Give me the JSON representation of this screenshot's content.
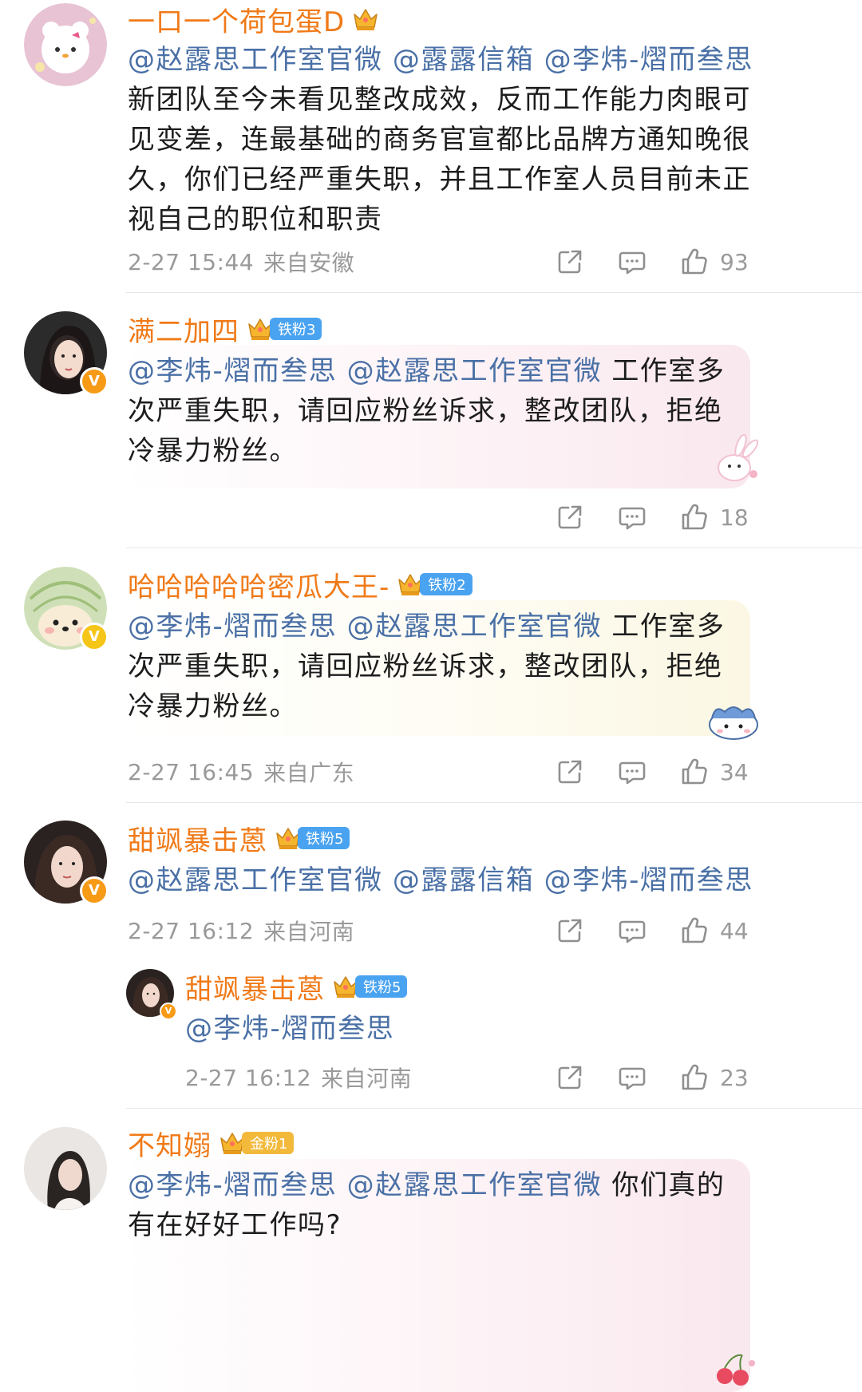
{
  "comments": [
    {
      "username": "一口一个荷包蛋D",
      "fan_badge": "",
      "text_mentions": [
        "@赵露思工作室官微",
        "@露露信箱",
        "@李炜-熠而叁思"
      ],
      "text_body": "新团队至今未看见整改成效，反而工作能力肉眼可见变差，连最基础的商务官宣都比品牌方通知晚很久，你们已经严重失职，并且工作室人员目前未正视自己的职位和职责",
      "timestamp": "2-27 15:44",
      "location": "来自安徽",
      "likes": "93"
    },
    {
      "username": "满二加四",
      "fan_badge": "铁粉3",
      "text_mentions": [
        "@李炜-熠而叁思",
        "@赵露思工作室官微"
      ],
      "text_body": "工作室多次严重失职，请回应粉丝诉求，整改团队，拒绝冷暴力粉丝。",
      "timestamp": "",
      "location": "",
      "likes": "18"
    },
    {
      "username": "哈哈哈哈哈密瓜大王-",
      "fan_badge": "铁粉2",
      "text_mentions": [
        "@李炜-熠而叁思",
        "@赵露思工作室官微"
      ],
      "text_body": "工作室多次严重失职，请回应粉丝诉求，整改团队，拒绝冷暴力粉丝。",
      "timestamp": "2-27 16:45",
      "location": "来自广东",
      "likes": "34"
    },
    {
      "username": "甜飒暴击蒽",
      "fan_badge": "铁粉5",
      "text_mentions": [
        "@赵露思工作室官微",
        "@露露信箱",
        "@李炜-熠而叁思"
      ],
      "text_body": "",
      "timestamp": "2-27 16:12",
      "location": "来自河南",
      "likes": "44"
    },
    {
      "username": "甜飒暴击蒽",
      "fan_badge": "铁粉5",
      "text_mentions": [
        "@李炜-熠而叁思"
      ],
      "text_body": "",
      "timestamp": "2-27 16:12",
      "location": "来自河南",
      "likes": "23"
    },
    {
      "username": "不知嫋",
      "fan_badge": "金粉1",
      "text_mentions": [
        "@李炜-熠而叁思",
        "@赵露思工作室官微"
      ],
      "text_body": "你们真的有在好好工作吗?",
      "timestamp": "",
      "location": "",
      "likes": ""
    }
  ],
  "colors": {
    "username": "#f07a18",
    "mention": "#4a70a6",
    "meta": "#9a9a9a",
    "iron_fan_badge": "#4aa3f0",
    "gold_fan_badge": "#f2b93b",
    "verified_badge": "#f79a16"
  },
  "icons": {
    "share": "share-icon",
    "comment": "comment-icon",
    "like": "thumbs-up-icon",
    "crown": "crown-icon",
    "verified": "verified-v-icon"
  }
}
